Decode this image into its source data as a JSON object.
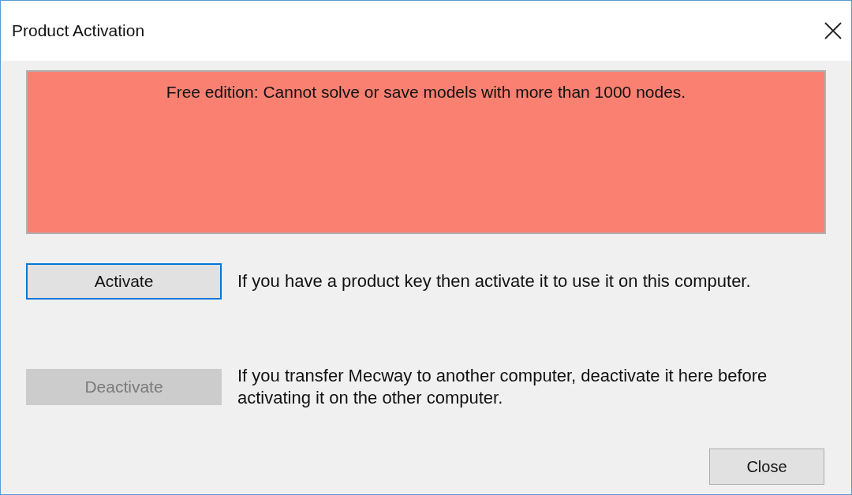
{
  "window": {
    "title": "Product Activation"
  },
  "notice": {
    "text": "Free edition: Cannot solve or save models with more than 1000 nodes."
  },
  "actions": [
    {
      "label": "Activate",
      "disabled": false,
      "focused": true,
      "description": "If you have a product key then activate it to use it on this computer."
    },
    {
      "label": "Deactivate",
      "disabled": true,
      "focused": false,
      "description": "If you transfer Mecway to another computer, deactivate it here before activating it on the other computer."
    }
  ],
  "close_button": {
    "label": "Close"
  }
}
